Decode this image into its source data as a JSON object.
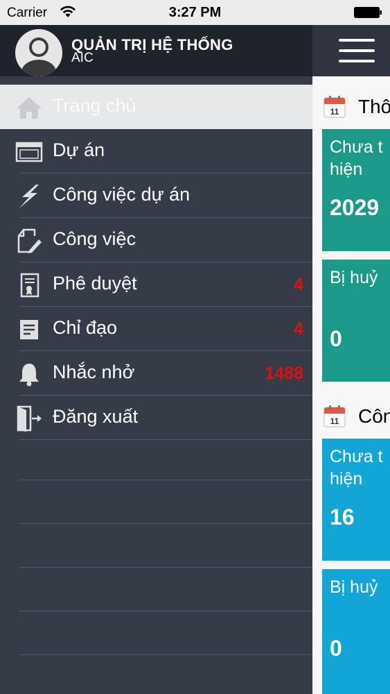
{
  "status_bar": {
    "carrier": "Carrier",
    "time": "3:27 PM"
  },
  "drawer": {
    "user_name": "QUẢN TRỊ HỆ THỐNG",
    "user_org": "AIC",
    "items": [
      {
        "label": "Trang chủ",
        "icon": "home-icon",
        "badge": ""
      },
      {
        "label": "Dự án",
        "icon": "window-icon",
        "badge": ""
      },
      {
        "label": "Công việc dự án",
        "icon": "lightning-icon",
        "badge": ""
      },
      {
        "label": "Công việc",
        "icon": "edit-document-icon",
        "badge": ""
      },
      {
        "label": "Phê duyệt",
        "icon": "certificate-icon",
        "badge": "4"
      },
      {
        "label": "Chỉ đạo",
        "icon": "notes-icon",
        "badge": "4"
      },
      {
        "label": "Nhắc nhở",
        "icon": "bell-icon",
        "badge": "1488"
      },
      {
        "label": "Đăng xuất",
        "icon": "logout-door-icon",
        "badge": ""
      }
    ]
  },
  "content": {
    "sections": [
      {
        "title": "Thô",
        "cards": [
          {
            "label": "Chưa t hiện",
            "value": "2029"
          },
          {
            "label": "Bị huỷ",
            "value": "0"
          }
        ]
      },
      {
        "title": "Côn",
        "cards": [
          {
            "label": "Chưa t hiện",
            "value": "16"
          },
          {
            "label": "Bị huỷ",
            "value": "0"
          }
        ]
      }
    ]
  },
  "colors": {
    "drawer_bg": "#353c48",
    "header_bg": "#1f232b",
    "badge": "#e01010",
    "card_green": "#1b9a8a",
    "card_blue": "#12a6d6"
  }
}
